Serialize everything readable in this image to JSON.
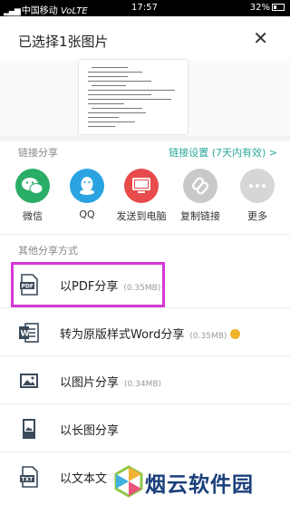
{
  "status_bar": {
    "carrier": "中国移动",
    "network": "VoLTE",
    "time": "17:57",
    "battery": "32%"
  },
  "sheet": {
    "title": "已选择1张图片",
    "close_icon": "close-icon"
  },
  "link_share": {
    "label": "链接分享",
    "settings": "链接设置 (7天内有效) >",
    "apps": [
      {
        "label": "微信",
        "icon": "wechat-icon",
        "color": "#2aae67"
      },
      {
        "label": "QQ",
        "icon": "qq-icon",
        "color": "#2aa3e1"
      },
      {
        "label": "发送到电脑",
        "icon": "computer-icon",
        "color": "#e84b4b"
      },
      {
        "label": "复制链接",
        "icon": "link-icon",
        "color": "#c9c9c9"
      },
      {
        "label": "更多",
        "icon": "more-icon",
        "color": "#d6d6d6"
      }
    ]
  },
  "other_share": {
    "label": "其他分享方式",
    "items": [
      {
        "label": "以PDF分享",
        "size": "(0.35MB)",
        "icon": "pdf-icon"
      },
      {
        "label": "转为原版样式Word分享",
        "size": "(0.35MB)",
        "icon": "word-icon"
      },
      {
        "label": "以图片分享",
        "size": "(0.34MB)",
        "icon": "image-icon"
      },
      {
        "label": "以长图分享",
        "size": "",
        "icon": "long-image-icon"
      },
      {
        "label": "以文本文字",
        "size": "",
        "icon": "txt-icon"
      }
    ]
  },
  "watermark": {
    "text": "烟云软件园"
  },
  "colors": {
    "accent": "#2aa79b",
    "highlight": "#d637d6"
  }
}
